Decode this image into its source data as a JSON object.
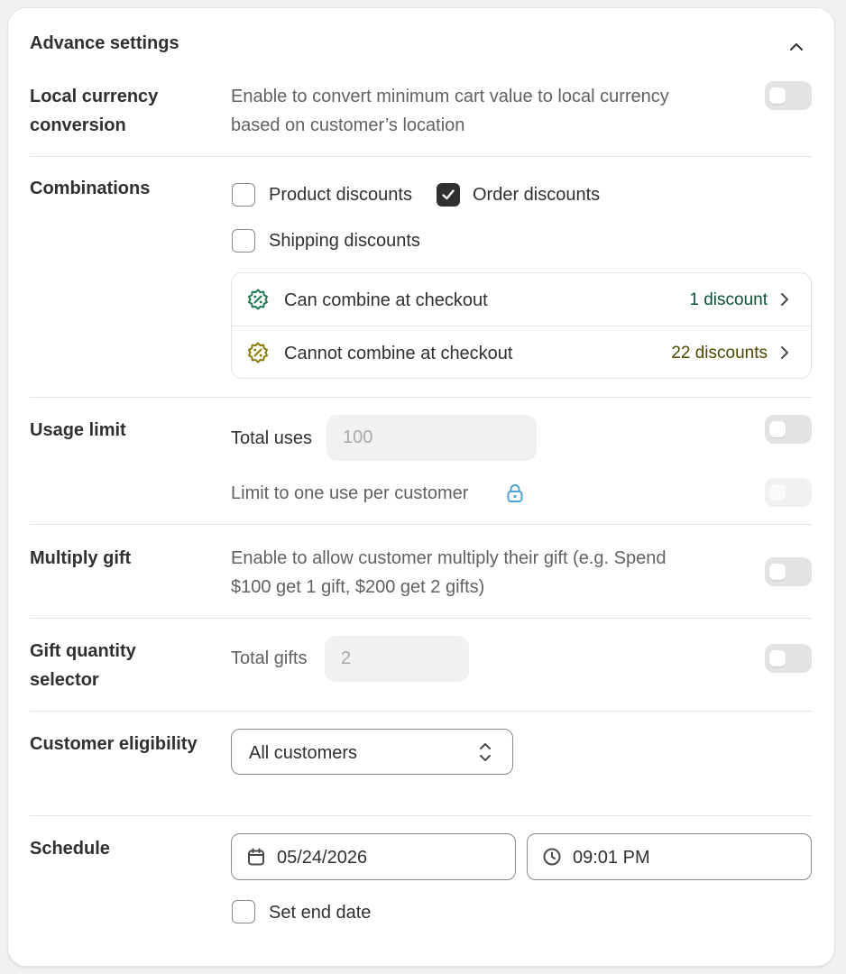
{
  "title": "Advance settings",
  "local_currency": {
    "label_line1": "Local currency",
    "label_line2": "conversion",
    "desc_line1": "Enable to convert minimum cart value to local currency",
    "desc_line2": "based on customer’s location"
  },
  "combinations": {
    "label": "Combinations",
    "options": [
      {
        "label": "Product discounts",
        "checked": false
      },
      {
        "label": "Order discounts",
        "checked": true
      },
      {
        "label": "Shipping discounts",
        "checked": false
      }
    ],
    "rows": [
      {
        "label": "Can combine at checkout",
        "count": "1 discount",
        "color": "#0c5132",
        "icon": "discount-badge-icon"
      },
      {
        "label": "Cannot combine at checkout",
        "count": "22 discounts",
        "color": "#4f4700",
        "icon": "discount-badge-icon"
      }
    ]
  },
  "usage_limit": {
    "label": "Usage limit",
    "total_uses_label": "Total uses",
    "total_uses_placeholder": "100",
    "one_use_label": "Limit to one use per customer",
    "lock_icon": "lock-icon",
    "lock_color": "#4ba3d9"
  },
  "multiply_gift": {
    "label": "Multiply gift",
    "desc_line1": "Enable to allow customer multiply their gift (e.g. Spend",
    "desc_line2": "$100 get 1 gift, $200 get 2 gifts)"
  },
  "gift_quantity": {
    "label_line1": "Gift quantity",
    "label_line2": "selector",
    "total_gifts_label": "Total gifts",
    "total_gifts_placeholder": "2"
  },
  "customer_eligibility": {
    "label": "Customer eligibility",
    "selected": "All customers"
  },
  "schedule": {
    "label": "Schedule",
    "date": "05/24/2026",
    "time": "09:01 PM",
    "end_date_label": "Set end date"
  }
}
